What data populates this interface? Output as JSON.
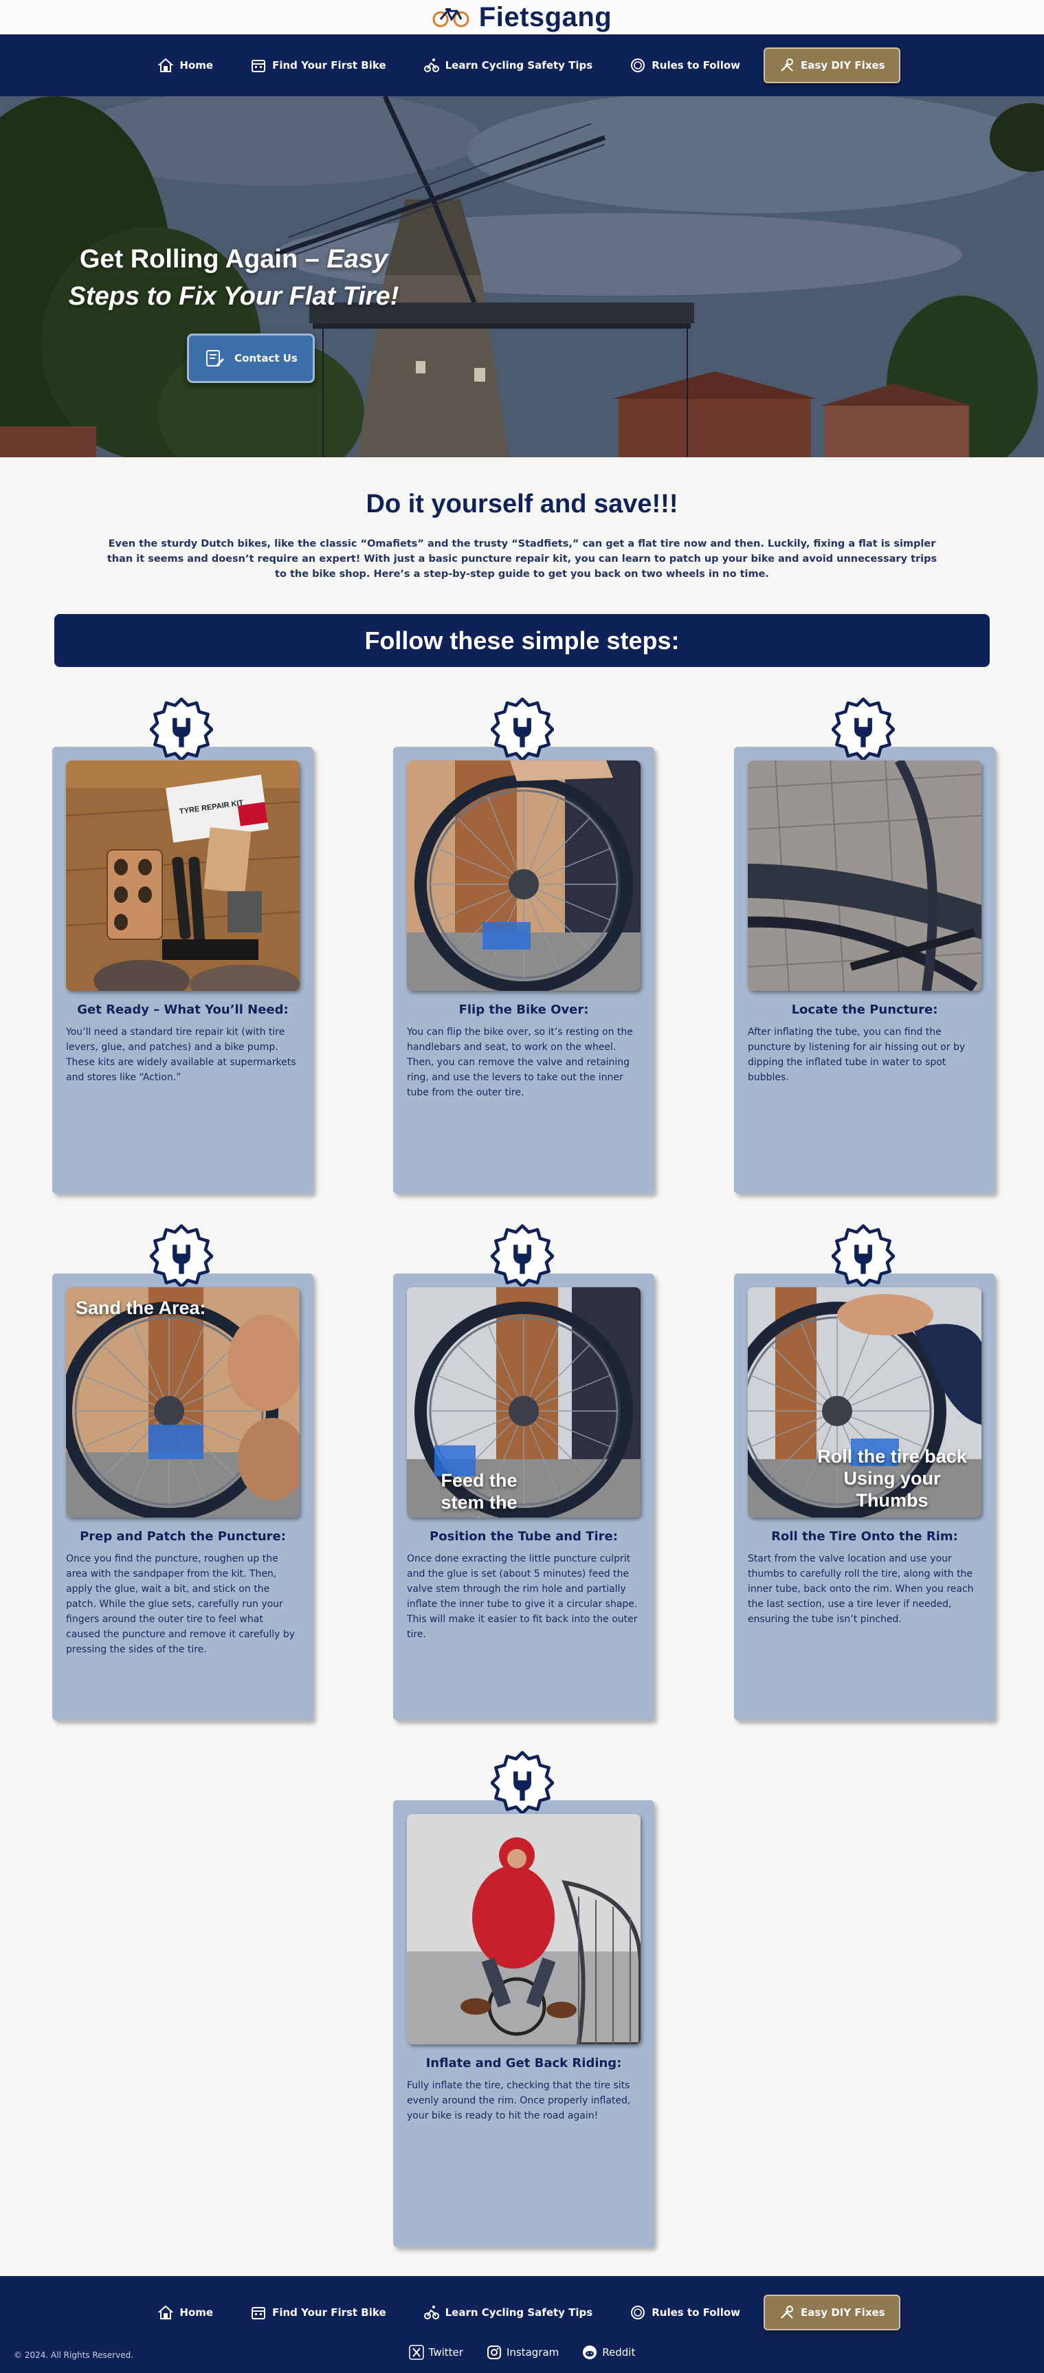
{
  "brand": {
    "name": "Fietsgang"
  },
  "nav": [
    {
      "label": "Home",
      "icon": "home-icon"
    },
    {
      "label": "Find Your First Bike",
      "icon": "calendar-icon"
    },
    {
      "label": "Learn Cycling Safety Tips",
      "icon": "cyclist-icon"
    },
    {
      "label": "Rules to Follow",
      "icon": "no-entry-sign-icon"
    },
    {
      "label": "Easy DIY Fixes",
      "icon": "tools-icon",
      "active": true
    }
  ],
  "hero": {
    "title_plain": "Get Rolling Again – ",
    "title_italic": "Easy Steps to Fix Your Flat Tire!",
    "contact_label": "Contact Us"
  },
  "intro": {
    "title": "Do it yourself and save!!!",
    "text": "Even the sturdy Dutch bikes, like the classic “Omafiets” and the trusty “Stadfiets,” can get a flat tire now and then. Luckily, fixing a flat is simpler than it seems and doesn’t require an expert! With just a basic puncture repair kit, you can learn to patch up your bike and avoid unnecessary trips to the bike shop. Here’s a step-by-step guide to get you back on two wheels in no time."
  },
  "steps_banner": "Follow these simple steps:",
  "steps": [
    {
      "title": "Get Ready – What You’ll Need:",
      "text": "You’ll need a standard tire repair kit (with tire levers, glue, and patches) and a bike pump. These kits are widely available at supermarkets and stores like “Action.”",
      "image_caption": "",
      "image_label": "TYRE REPAIR KIT"
    },
    {
      "title": "Flip the Bike Over:",
      "text": "You can flip the bike over, so it’s resting on the handlebars and seat, to work on the wheel. Then, you can remove the valve and retaining ring, and use the levers to take out the inner tube from the outer tire.",
      "image_caption": ""
    },
    {
      "title": "Locate the Puncture:",
      "text": "After inflating the tube, you can find the puncture by listening for air hissing out or by dipping the inflated tube in water to spot bubbles.",
      "image_caption": ""
    },
    {
      "title": "Prep and Patch the Puncture:",
      "text": "Once you find the puncture, roughen up the area with the sandpaper from the kit. Then, apply the glue, wait a bit, and stick on the patch. While the glue sets, carefully run your fingers around the outer tire to feel what caused the puncture and remove it carefully by pressing the sides of the tire.",
      "image_caption": "Sand the Area:"
    },
    {
      "title": "Position the Tube and Tire:",
      "text": "Once done exracting the little puncture culprit and the glue is set (about 5 minutes) feed the valve stem through the rim hole and partially inflate the inner tube to give it a circular shape. This will make it easier to fit back into the outer tire.",
      "image_caption": "Feed the stem the valve"
    },
    {
      "title": "Roll the Tire Onto the Rim:",
      "text": "Start from the valve location and use your thumbs to carefully roll the tire, along with the inner tube, back onto the rim. When you reach the last section, use a tire lever if needed, ensuring the tube isn’t pinched.",
      "image_caption": "Roll the tire back Using your Thumbs"
    },
    {
      "title": "Inflate and Get Back Riding:",
      "text": "Fully inflate the tire, checking that the tire sits evenly around the rim. Once properly inflated, your bike is ready to hit the road again!",
      "image_caption": ""
    }
  ],
  "footer": {
    "copyright": "© 2024. All Rights Reserved.",
    "socials": [
      {
        "label": "Twitter",
        "icon": "x-logo-icon"
      },
      {
        "label": "Instagram",
        "icon": "instagram-icon"
      },
      {
        "label": "Reddit",
        "icon": "reddit-icon"
      }
    ]
  },
  "colors": {
    "navy": "#0f2257",
    "card": "#a6b8d0",
    "accent": "#8f7a52",
    "button": "#3c6ea8"
  }
}
